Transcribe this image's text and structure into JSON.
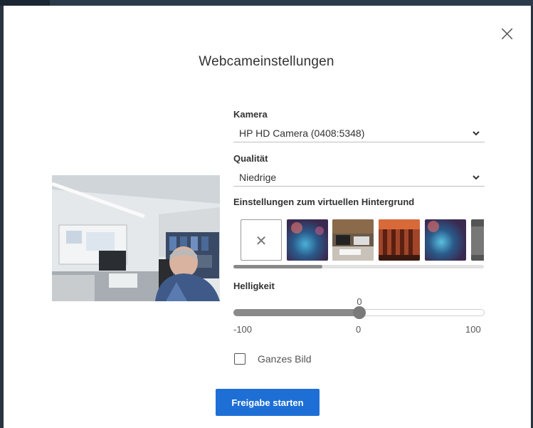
{
  "dialog": {
    "title": "Webcameinstellungen",
    "close_icon": "close-icon"
  },
  "camera": {
    "label": "Kamera",
    "selected": "HP HD Camera (0408:5348)"
  },
  "quality": {
    "label": "Qualität",
    "selected": "Niedrige"
  },
  "virtual_background": {
    "label": "Einstellungen zum virtuellen Hintergrund",
    "options": [
      "none",
      "blue-bokeh",
      "office-desk",
      "orange-corridor",
      "blue-bokeh-2",
      "gray-partial"
    ]
  },
  "brightness": {
    "label": "Helligkeit",
    "value": "0",
    "min": "-100",
    "mid": "0",
    "max": "100",
    "level_fraction": 0.5
  },
  "full_image": {
    "label": "Ganzes Bild",
    "checked": false
  },
  "actions": {
    "start_label": "Freigabe starten"
  },
  "colors": {
    "primary": "#1d6fd6",
    "slider": "#8a8a8a"
  }
}
